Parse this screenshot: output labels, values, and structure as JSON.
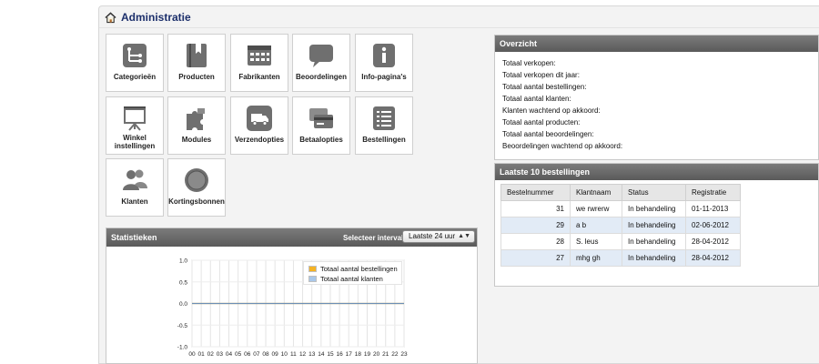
{
  "header": {
    "title": "Administratie",
    "icon": "house-icon"
  },
  "tiles": [
    {
      "label": "Categorieën",
      "icon": "category-tree-icon"
    },
    {
      "label": "Producten",
      "icon": "book-icon"
    },
    {
      "label": "Fabrikanten",
      "icon": "grid-calendar-icon"
    },
    {
      "label": "Beoordelingen",
      "icon": "speech-bubble-icon"
    },
    {
      "label": "Info-pagina's",
      "icon": "info-icon"
    },
    {
      "label": "Winkel instellingen",
      "icon": "presentation-board-icon"
    },
    {
      "label": "Modules",
      "icon": "puzzle-icon"
    },
    {
      "label": "Verzendopties",
      "icon": "truck-icon"
    },
    {
      "label": "Betaalopties",
      "icon": "credit-card-icon"
    },
    {
      "label": "Bestellingen",
      "icon": "list-icon"
    },
    {
      "label": "Klanten",
      "icon": "users-icon"
    },
    {
      "label": "Kortingsbonnen",
      "icon": "coin-icon"
    }
  ],
  "overview": {
    "title": "Overzicht",
    "lines": [
      "Totaal verkopen:",
      "Totaal verkopen dit jaar:",
      "Totaal aantal bestellingen:",
      "Totaal aantal klanten:",
      "Klanten wachtend op akkoord:",
      "Totaal aantal producten:",
      "Totaal aantal beoordelingen:",
      "Beoordelingen wachtend op akkoord:"
    ]
  },
  "orders": {
    "title": "Laatste 10 bestellingen",
    "columns": [
      "Bestelnummer",
      "Klantnaam",
      "Status",
      "Registratie"
    ],
    "rows": [
      [
        "31",
        "we rwrerw",
        "In behandeling",
        "01-11-2013"
      ],
      [
        "29",
        "a b",
        "In behandeling",
        "02-06-2012"
      ],
      [
        "28",
        "S. leus",
        "In behandeling",
        "28-04-2012"
      ],
      [
        "27",
        "mhg gh",
        "In behandeling",
        "28-04-2012"
      ]
    ]
  },
  "stats": {
    "title": "Statistieken",
    "interval_label": "Selecteer interval:",
    "interval_value": "Laatste 24 uur"
  },
  "chart_data": {
    "type": "line",
    "x": [
      "00",
      "01",
      "02",
      "03",
      "04",
      "05",
      "06",
      "07",
      "08",
      "09",
      "10",
      "11",
      "12",
      "13",
      "14",
      "15",
      "16",
      "17",
      "18",
      "19",
      "20",
      "21",
      "22",
      "23"
    ],
    "yticks": [
      "1.0",
      "0.5",
      "0.0",
      "-0.5",
      "-1.0"
    ],
    "ylim": [
      -1.0,
      1.0
    ],
    "grid": true,
    "legend_position": "top-right",
    "series": [
      {
        "name": "Totaal aantal bestellingen",
        "color": "#f5b323",
        "values": [
          0,
          0,
          0,
          0,
          0,
          0,
          0,
          0,
          0,
          0,
          0,
          0,
          0,
          0,
          0,
          0,
          0,
          0,
          0,
          0,
          0,
          0,
          0,
          0
        ]
      },
      {
        "name": "Totaal aantal klanten",
        "color": "#a9c8ea",
        "values": [
          0,
          0,
          0,
          0,
          0,
          0,
          0,
          0,
          0,
          0,
          0,
          0,
          0,
          0,
          0,
          0,
          0,
          0,
          0,
          0,
          0,
          0,
          0,
          0
        ]
      }
    ]
  }
}
